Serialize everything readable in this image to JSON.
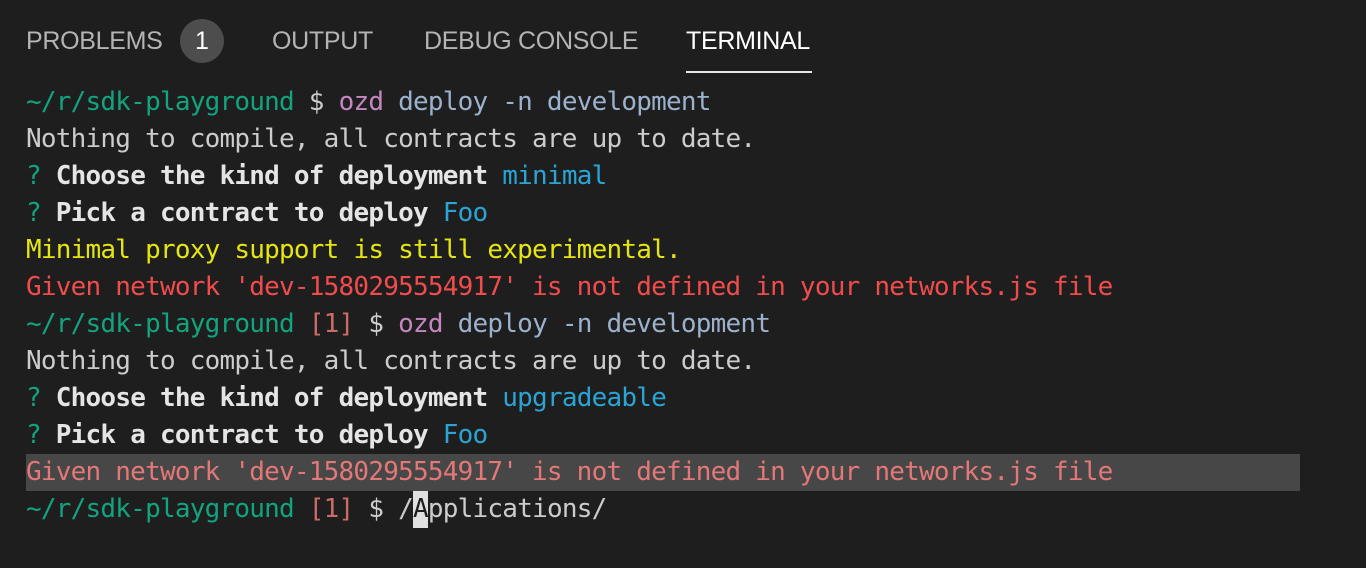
{
  "tabs": {
    "problems": "PROBLEMS",
    "problems_count": "1",
    "output": "OUTPUT",
    "debug_console": "DEBUG CONSOLE",
    "terminal": "TERMINAL",
    "active": "TERMINAL"
  },
  "terminal": {
    "l1": {
      "prompt": "~/r/sdk-playground",
      "dollar": " $ ",
      "cmd": "ozd",
      "args": " deploy -n development"
    },
    "l2": {
      "text": "Nothing to compile, all contracts are up to date."
    },
    "l3": {
      "mark": "? ",
      "question": "Choose the kind of deployment",
      "answer": " minimal"
    },
    "l4": {
      "mark": "? ",
      "question": "Pick a contract to deploy",
      "answer": " Foo"
    },
    "l5": {
      "text": "Minimal proxy support is still experimental."
    },
    "l6": {
      "text": "Given network 'dev-1580295554917' is not defined in your networks.js file"
    },
    "l7": {
      "prompt": "~/r/sdk-playground",
      "code": " [1]",
      "dollar": " $ ",
      "cmd": "ozd",
      "args": " deploy -n development"
    },
    "l8": {
      "text": "Nothing to compile, all contracts are up to date."
    },
    "l9": {
      "mark": "? ",
      "question": "Choose the kind of deployment",
      "answer": " upgradeable"
    },
    "l10": {
      "mark": "? ",
      "question": "Pick a contract to deploy",
      "answer": " Foo"
    },
    "l11": {
      "text": "Given network 'dev-1580295554917' is not defined in your networks.js file"
    },
    "l12": {
      "prompt": "~/r/sdk-playground",
      "code": " [1]",
      "dollar": " $ ",
      "input_before": "/",
      "cursor_char": "A",
      "input_after": "pplications/"
    }
  },
  "colors": {
    "background": "#1e1e1e",
    "prompt": "#11a47f",
    "error": "#f14c4c",
    "warning": "#e5e510",
    "answer": "#2aa4d4",
    "command": "#c586c0"
  }
}
